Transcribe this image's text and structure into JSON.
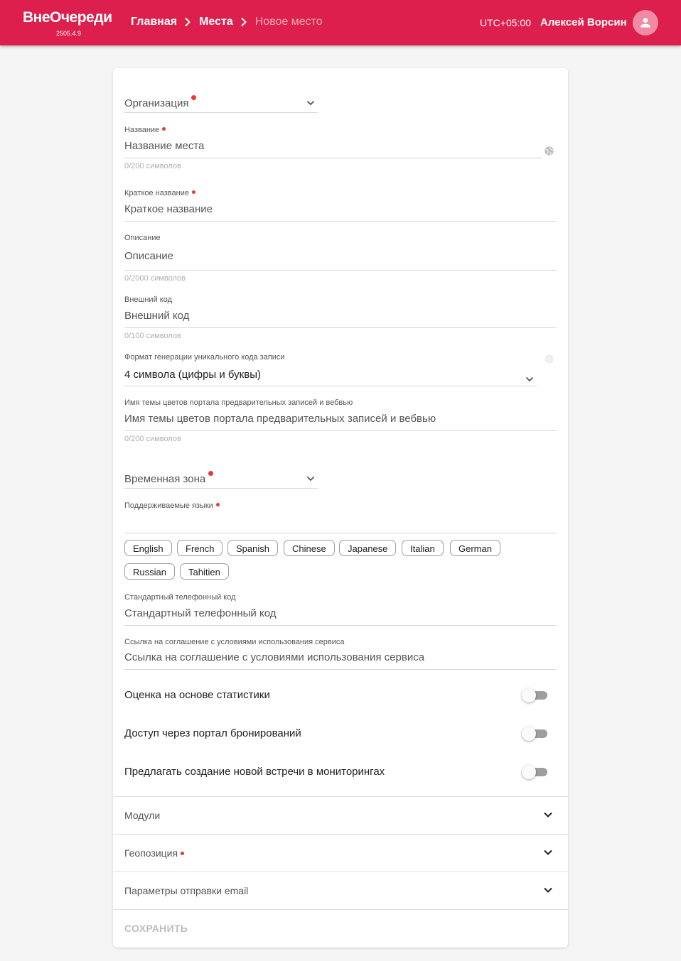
{
  "header": {
    "logo": "ВнеОчереди",
    "version": "2505.4.9",
    "breadcrumbs": [
      "Главная",
      "Места",
      "Новое место"
    ],
    "timezone": "UTC+05:00",
    "user_name": "Алексей Ворсин",
    "avatar_icon": "person-icon",
    "brand_color": "#dc1f4c"
  },
  "form": {
    "organization": {
      "label": "Организация"
    },
    "name": {
      "label": "Название",
      "placeholder": "Название места",
      "counter": "0/200 символов"
    },
    "short_name": {
      "label": "Краткое название",
      "placeholder": "Краткое название"
    },
    "description": {
      "label": "Описание",
      "placeholder": "Описание",
      "counter": "0/2000 символов"
    },
    "external_code": {
      "label": "Внешний код",
      "placeholder": "Внешний код",
      "counter": "0/100 символов"
    },
    "code_format": {
      "label": "Формат генерации уникального кода записи",
      "value": "4 символа (цифры и буквы)"
    },
    "theme_name": {
      "label": "Имя темы цветов портала предварительных записей и вебвью",
      "placeholder": "Имя темы цветов портала предварительных записей и вебвью",
      "counter": "0/200 символов"
    },
    "timezone": {
      "label": "Временная зона"
    },
    "languages": {
      "label": "Поддерживаемые языки",
      "options": [
        "English",
        "French",
        "Spanish",
        "Chinese",
        "Japanese",
        "Italian",
        "German",
        "Russian",
        "Tahitien"
      ]
    },
    "phone_code": {
      "label": "Стандартный телефонный код",
      "placeholder": "Стандартный телефонный код"
    },
    "terms_link": {
      "label": "Ссылка на соглашение с условиями использования сервиса",
      "placeholder": "Ссылка на соглашение с условиями использования сервиса"
    },
    "toggles": [
      {
        "label": "Оценка на основе статистики",
        "on": false
      },
      {
        "label": "Доступ через портал бронирований",
        "on": false
      },
      {
        "label": "Предлагать создание новой встречи в мониторингах",
        "on": false
      }
    ],
    "sections": [
      "Модули",
      "Геопозиция",
      "Параметры отправки email"
    ],
    "save_label": "СОХРАНИТЬ"
  }
}
